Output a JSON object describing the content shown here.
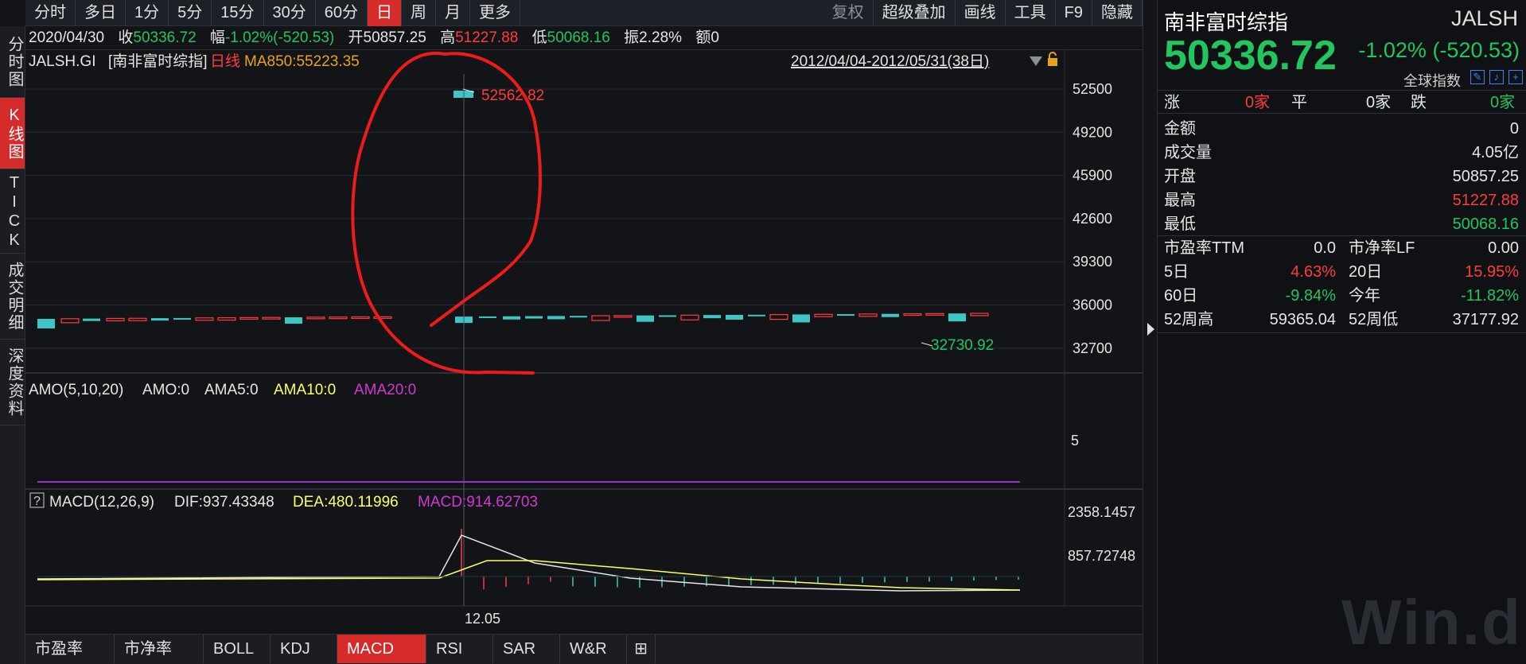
{
  "toolbar": {
    "periods": [
      "分时",
      "多日",
      "1分",
      "5分",
      "15分",
      "30分",
      "60分",
      "日",
      "周",
      "月",
      "更多"
    ],
    "active_period": "日",
    "right_items": [
      "复权",
      "超级叠加",
      "画线",
      "工具",
      "F9",
      "隐藏"
    ]
  },
  "leftnav": [
    {
      "label": "分时图",
      "active": false
    },
    {
      "label": "K线图",
      "active": true
    },
    {
      "label": "TICK",
      "active": false
    },
    {
      "label": "成交明细",
      "active": false
    },
    {
      "label": "深度资料",
      "active": false
    }
  ],
  "infoline": {
    "date": "2020/04/30",
    "close_label": "收",
    "close": "50336.72",
    "change_label": "幅",
    "change": "-1.02%(-520.53)",
    "open_label": "开",
    "open": "50857.25",
    "high_label": "高",
    "high": "51227.88",
    "low_label": "低",
    "low": "50068.16",
    "amp_label": "振",
    "amp": "2.28%",
    "amount_label": "额",
    "amount": "0"
  },
  "main_chart": {
    "symbol": "JALSH.GI",
    "name": "[南非富时综指]",
    "period_label": "日线",
    "ma_label": "MA850:55223.35",
    "range": "2012/04/04-2012/05/31(38日)",
    "y_ticks": [
      "52500",
      "49200",
      "45900",
      "42600",
      "39300",
      "36000",
      "32700"
    ],
    "max_label": "52562.82",
    "min_label": "32730.92"
  },
  "amo_panel": {
    "title": "AMO(5,10,20)",
    "amo": "AMO:0",
    "ama5": "AMA5:0",
    "ama10": "AMA10:0",
    "ama20": "AMA20:0",
    "y_tick": "5"
  },
  "macd_panel": {
    "help": "?",
    "title": "MACD(12,26,9)",
    "dif": "DIF:937.43348",
    "dea": "DEA:480.11996",
    "macd": "MACD:914.62703",
    "y_ticks": [
      "2358.1457",
      "857.72748"
    ],
    "x_label": "12.05"
  },
  "bottom_tabs": [
    "市盈率",
    "市净率",
    "BOLL",
    "KDJ",
    "MACD",
    "RSI",
    "SAR",
    "W&R"
  ],
  "active_bottom_tab": "MACD",
  "right_panel": {
    "name": "南非富时综指",
    "code": "JALSH",
    "price": "50336.72",
    "change": "-1.02% (-520.53)",
    "global_label": "全球指数",
    "breadth": {
      "up_label": "涨",
      "up": "0家",
      "flat_label": "平",
      "flat": "0家",
      "down_label": "跌",
      "down": "0家"
    },
    "stats": [
      {
        "label": "金额",
        "value": "0",
        "color": "#e6e6e6"
      },
      {
        "label": "成交量",
        "value": "4.05亿",
        "color": "#e6e6e6"
      },
      {
        "label": "开盘",
        "value": "50857.25",
        "color": "#e6e6e6"
      },
      {
        "label": "最高",
        "value": "51227.88",
        "color": "#ff3b3b"
      },
      {
        "label": "最低",
        "value": "50068.16",
        "color": "#22c55e"
      }
    ],
    "grid": [
      {
        "l1": "市盈率TTM",
        "v1": "0.0",
        "c1": "#e6e6e6",
        "l2": "市净率LF",
        "v2": "0.00",
        "c2": "#e6e6e6"
      },
      {
        "l1": "5日",
        "v1": "4.63%",
        "c1": "#ff3b3b",
        "l2": "20日",
        "v2": "15.95%",
        "c2": "#ff3b3b"
      },
      {
        "l1": "60日",
        "v1": "-9.84%",
        "c1": "#22c55e",
        "l2": "今年",
        "v2": "-11.82%",
        "c2": "#22c55e"
      },
      {
        "l1": "52周高",
        "v1": "59365.04",
        "c1": "#e6e6e6",
        "l2": "52周低",
        "v2": "37177.92",
        "c2": "#e6e6e6"
      }
    ],
    "watermark": "Win.d"
  },
  "colors": {
    "up": "#ff3b3b",
    "down": "#22c55e",
    "active": "#d52b2b",
    "cyan": "#3ec6c6",
    "bg": "#121418"
  }
}
